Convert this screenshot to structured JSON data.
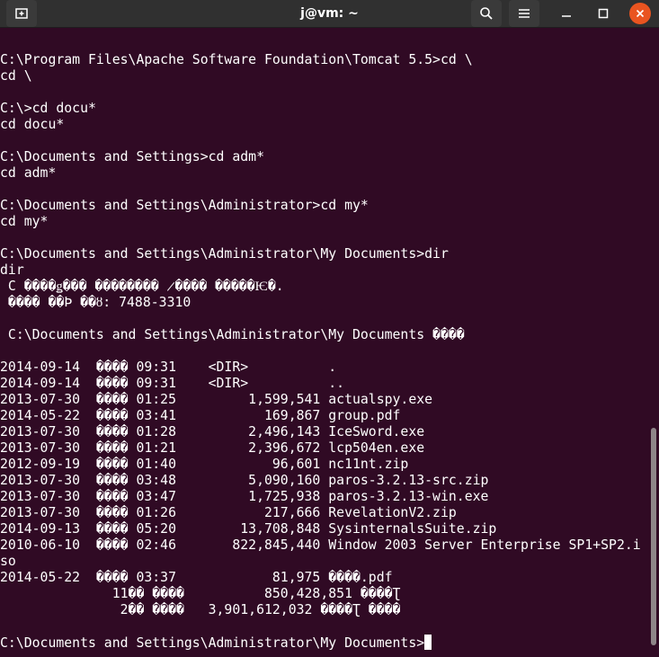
{
  "window": {
    "title": "j@vm: ~",
    "icons": {
      "new_tab": "new-tab-icon",
      "search": "search-icon",
      "menu": "hamburger-menu-icon",
      "minimize": "minimize-icon",
      "maximize": "maximize-icon",
      "close": "close-icon"
    },
    "close_color": "#e95420"
  },
  "terminal": {
    "background": "#300a24",
    "lines": [
      "C:\\Program Files\\Apache Software Foundation\\Tomcat 5.5>cd \\",
      "cd \\",
      "",
      "C:\\>cd docu*",
      "cd docu*",
      "",
      "C:\\Documents and Settings>cd adm*",
      "cd adm*",
      "",
      "C:\\Documents and Settings\\Administrator>cd my*",
      "cd my*",
      "",
      "C:\\Documents and Settings\\Administrator\\My Documents>dir",
      "dir",
      " C ����ǥ��� �������� ̷���� �����Ѥ�.",
      " ���� ��Ϸ ��ȣ: 7488-3310",
      "",
      " C:\\Documents and Settings\\Administrator\\My Documents ���͸�",
      "",
      "2014-09-14  ���� 09:31    <DIR>          .",
      "2014-09-14  ���� 09:31    <DIR>          ..",
      "2013-07-30  ���� 01:25         1,599,541 actualspy.exe",
      "2014-05-22  ���� 03:41           169,867 group.pdf",
      "2013-07-30  ���� 01:28         2,496,143 IceSword.exe",
      "2013-07-30  ���� 01:21         2,396,672 lcp504en.exe",
      "2012-09-19  ���� 01:40            96,601 nc11nt.zip",
      "2013-07-30  ���� 03:48         5,090,160 paros-3.2.13-src.zip",
      "2013-07-30  ���� 03:47         1,725,938 paros-3.2.13-win.exe",
      "2013-07-30  ���� 01:26           217,666 RevelationV2.zip",
      "2014-09-13  ���� 05:20        13,708,848 SysinternalsSuite.zip",
      "2010-06-10  ���� 02:46       822,845,440 Window 2003 Server Enterprise SP1+SP2.i",
      "so",
      "2014-05-22  ���� 03:37            81,975 ����.pdf",
      "              11�� ����          850,428,851 ����Ʈ",
      "               2�� ���͸�   3,901,612,032 ����Ʈ ����",
      ""
    ],
    "prompt": "C:\\Documents and Settings\\Administrator\\My Documents>"
  }
}
